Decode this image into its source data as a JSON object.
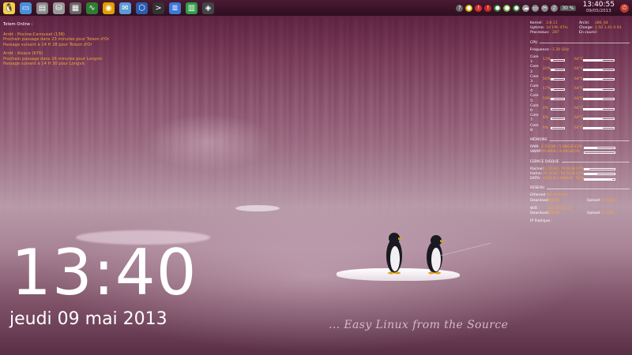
{
  "panel": {
    "launchers": [
      {
        "icon": "tux-icon",
        "color": "#f4d03f",
        "glyph": "🐧"
      },
      {
        "icon": "window-icon",
        "color": "#4a90d9",
        "glyph": "▭"
      },
      {
        "icon": "drawer-icon",
        "color": "#888888",
        "glyph": "▤"
      },
      {
        "icon": "hard-drive-icon",
        "color": "#999999",
        "glyph": "⛁"
      },
      {
        "icon": "calculator-icon",
        "color": "#666666",
        "glyph": "▦"
      },
      {
        "icon": "system-monitor-icon",
        "color": "#2e7d32",
        "glyph": "∿"
      },
      {
        "icon": "chrome-icon",
        "color": "#e0a000",
        "glyph": "◉"
      },
      {
        "icon": "mail-icon",
        "color": "#5b9bd5",
        "glyph": "✉"
      },
      {
        "icon": "virtualbox-icon",
        "color": "#2a5db0",
        "glyph": "⬡"
      },
      {
        "icon": "terminal-icon",
        "color": "#333333",
        "glyph": ">"
      },
      {
        "icon": "writer-icon",
        "color": "#3c78d8",
        "glyph": "≣"
      },
      {
        "icon": "calc-icon",
        "color": "#2e9d47",
        "glyph": "▥"
      },
      {
        "icon": "fish-icon",
        "color": "#444444",
        "glyph": "◈"
      }
    ],
    "tray": [
      {
        "icon": "help-icon",
        "color": "#666666",
        "glyph": "?"
      },
      {
        "icon": "shield-icon",
        "color": "#d4b000",
        "glyph": "●"
      },
      {
        "icon": "update-icon",
        "color": "#d32f2f",
        "glyph": "!"
      },
      {
        "icon": "alert-icon",
        "color": "#c62828",
        "glyph": "!"
      },
      {
        "icon": "network-icon",
        "color": "#2e7d32",
        "glyph": "●"
      },
      {
        "icon": "leaf-icon",
        "color": "#7cb342",
        "glyph": "●"
      },
      {
        "icon": "chat-icon",
        "color": "#2e7d32",
        "glyph": "●"
      },
      {
        "icon": "cloud-icon",
        "color": "#999999",
        "glyph": "☁"
      },
      {
        "icon": "mail-tray-icon",
        "color": "#888888",
        "glyph": "▭"
      },
      {
        "icon": "scissors-icon",
        "color": "#888888",
        "glyph": "✂"
      },
      {
        "icon": "volume-icon",
        "color": "#888888",
        "glyph": "♪"
      }
    ],
    "volume_percent": "30 %",
    "clock_time": "13:40:55",
    "clock_date": "09/05/2013",
    "logout_icon": "power-icon"
  },
  "totem": {
    "title": "Totem Online :",
    "lines_a": [
      "Arrêt : Piscine-Carrousel  (138)",
      "Prochain passage dans 23 minutes pour Toison d'Or",
      "Passage suivant à 14 H 28 pour Toison d'Or"
    ],
    "lines_b": [
      "Arrêt : Alsace  (676)",
      "Prochain passage dans 26 minutes pour Longvic",
      "Passage suivant à 14 H 30 pour Longvic"
    ]
  },
  "sysmon": {
    "kernel_label": "Kernel:",
    "kernel": "3.8.11",
    "arch_label": "Archi:",
    "arch": "x86_64",
    "uptime_label": "Uptime:",
    "uptime": "1d 19h 47m",
    "charge_label": "Charge:",
    "charge": "1.50 1.41 0.93",
    "process_label": "Processus:",
    "process": "287",
    "running_label": "En cours:",
    "running": "0",
    "cpu_title": "CPU",
    "freq_label": "Frequence :",
    "freq": "1.20 GHz",
    "cores": [
      {
        "name": "Core 1:",
        "pct": "13%",
        "load": 13,
        "temp": "64°C",
        "temp_fill": 64
      },
      {
        "name": "Core 2:",
        "pct": "22%",
        "load": 22,
        "temp": "64°C",
        "temp_fill": 64
      },
      {
        "name": "Core 3:",
        "pct": "16%",
        "load": 16,
        "temp": "64°C",
        "temp_fill": 64
      },
      {
        "name": "Core 4:",
        "pct": "17%",
        "load": 17,
        "temp": "64°C",
        "temp_fill": 64
      },
      {
        "name": "Core 5:",
        "pct": "19%",
        "load": 19,
        "temp": "64°C",
        "temp_fill": 64
      },
      {
        "name": "Core 6:",
        "pct": "4%",
        "load": 4,
        "temp": "64°C",
        "temp_fill": 64
      },
      {
        "name": "Core 7:",
        "pct": "6%",
        "load": 6,
        "temp": "64°C",
        "temp_fill": 64
      },
      {
        "name": "Core 8:",
        "pct": "6%",
        "load": 6,
        "temp": "64°C",
        "temp_fill": 64
      }
    ],
    "mem_title": "MÉMOIRE",
    "ram_label": "RAM:",
    "ram": "2.53GiB / 5.88GiB",
    "ram_pct": "43%",
    "ram_fill": 43,
    "swap_label": "SWAP:",
    "swap": "59.9MiB / 8.00GiB",
    "swap_pct": "0%",
    "swap_fill": 0,
    "disk_title": "ESPACE DISQUE",
    "disks": [
      {
        "name": "Racine:",
        "value": "13.7GiB / 79.9GiB",
        "pct": "17%",
        "fill": 17
      },
      {
        "name": "Home:",
        "value": "39.3GiB / 92.5GiB",
        "pct": "42%",
        "fill": 42
      },
      {
        "name": "DATA:",
        "value": "456GiB / 499GiB",
        "pct": "92%",
        "fill": 92
      }
    ],
    "net_title": "RESEAU",
    "eth_label": "Ethernet :",
    "eth": "No Address",
    "eth_down_label": "Download :",
    "eth_down": "0.0KiB",
    "eth_up_label": "Upload :",
    "eth_up": "0.0KiB",
    "wifi_label": "WiFi :",
    "wifi": "192.168.1.12",
    "wifi_down_label": "Download :",
    "wifi_down": "0.7KiB",
    "wifi_up_label": "Upload :",
    "wifi_up": "1.7KiB",
    "ip_label": "IP Publique :",
    "ip": ""
  },
  "clock": {
    "time": "13:40",
    "date": "jeudi 09 mai 2013"
  },
  "tagline": "... Easy Linux from the Source"
}
